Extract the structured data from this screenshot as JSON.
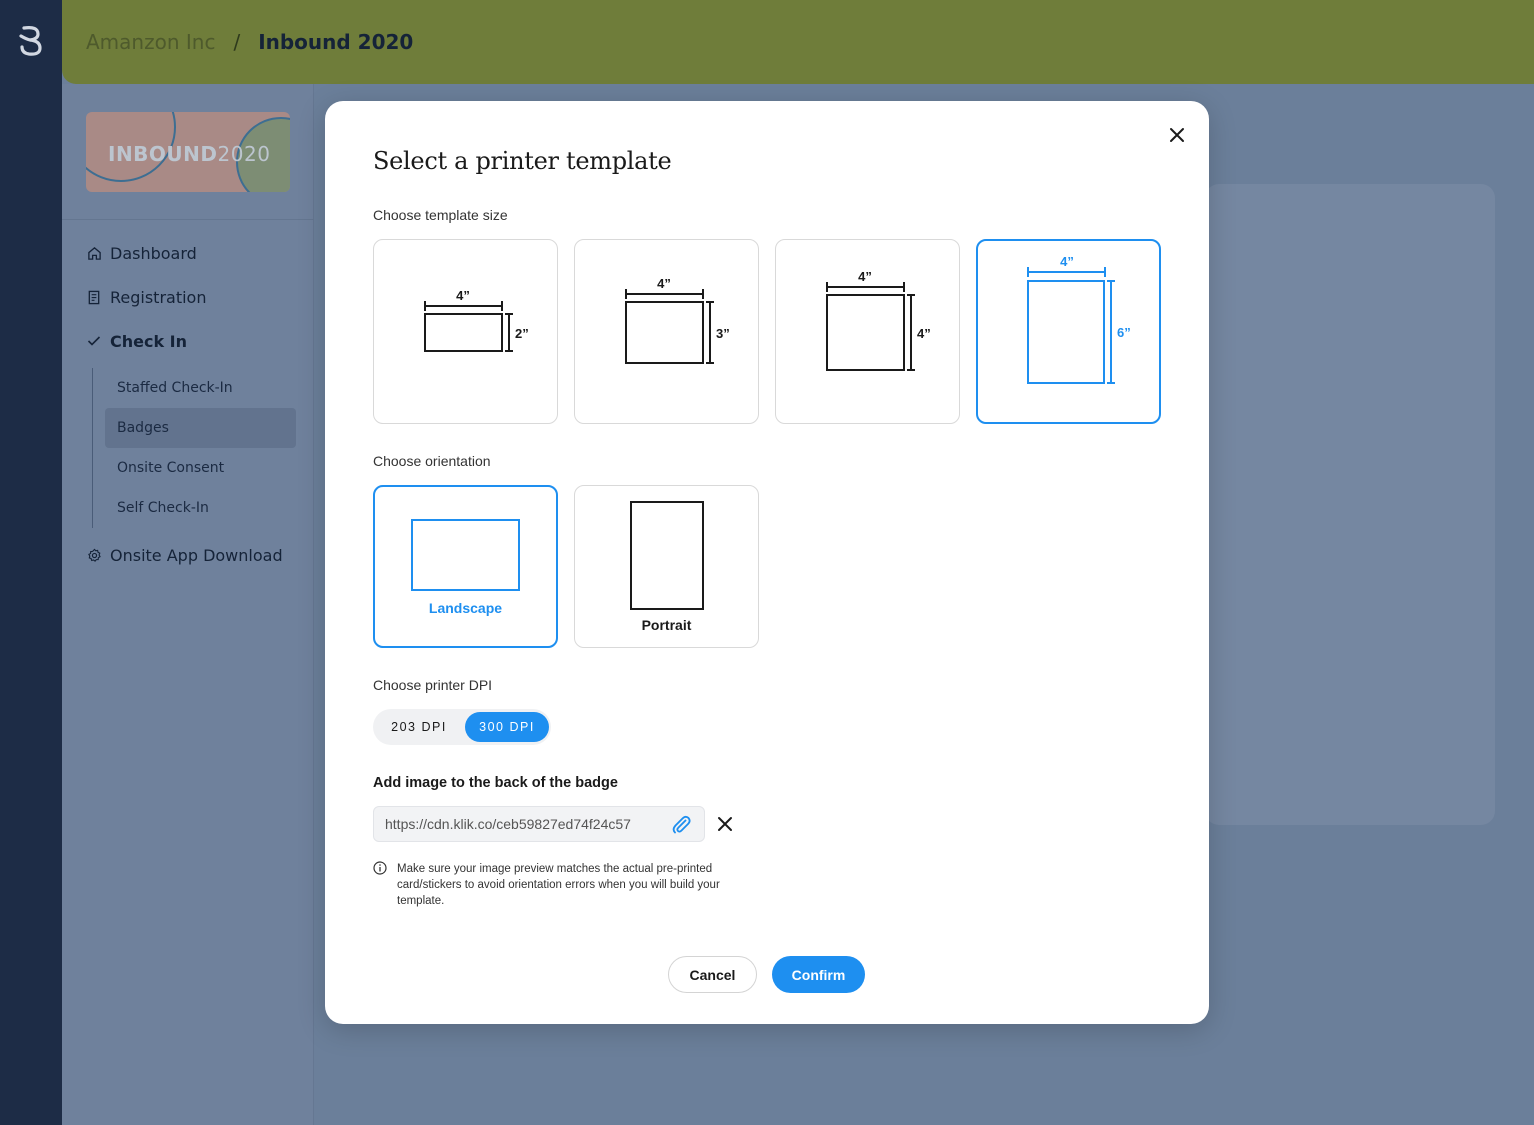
{
  "breadcrumb": {
    "org": "Amanzon Inc",
    "separator": "/",
    "event": "Inbound 2020"
  },
  "event_banner": {
    "bold": "INBOUND",
    "light": "2020"
  },
  "sidebar": {
    "items": [
      {
        "label": "Dashboard",
        "icon": "home-icon"
      },
      {
        "label": "Registration",
        "icon": "document-icon"
      },
      {
        "label": "Check In",
        "icon": "check-icon"
      },
      {
        "label": "Onsite App Download",
        "icon": "gear-icon"
      }
    ],
    "checkin_sub": [
      "Staffed Check-In",
      "Badges",
      "Onsite Consent",
      "Self Check-In"
    ],
    "active_sub": "Badges"
  },
  "modal": {
    "title": "Select a printer template",
    "size_label": "Choose template size",
    "sizes": [
      {
        "w": "4”",
        "h": "2”"
      },
      {
        "w": "4”",
        "h": "3”"
      },
      {
        "w": "4”",
        "h": "4”"
      },
      {
        "w": "4”",
        "h": "6”"
      }
    ],
    "selected_size": "4x6",
    "orientation_label": "Choose orientation",
    "orientations": [
      "Landscape",
      "Portrait"
    ],
    "selected_orientation": "Landscape",
    "dpi_label": "Choose printer DPI",
    "dpi_options": [
      "203 DPI",
      "300 DPI"
    ],
    "selected_dpi": "300 DPI",
    "image_label": "Add image to the back of the badge",
    "image_url": "https://cdn.klik.co/ceb59827ed74f24c57",
    "info_text": "Make sure your image preview matches the actual pre-printed card/stickers to avoid orientation errors when you will build your template.",
    "cancel": "Cancel",
    "confirm": "Confirm"
  },
  "colors": {
    "accent": "#1e8ff0",
    "topbar": "#6f7d3a",
    "rail": "#1d2c46"
  }
}
